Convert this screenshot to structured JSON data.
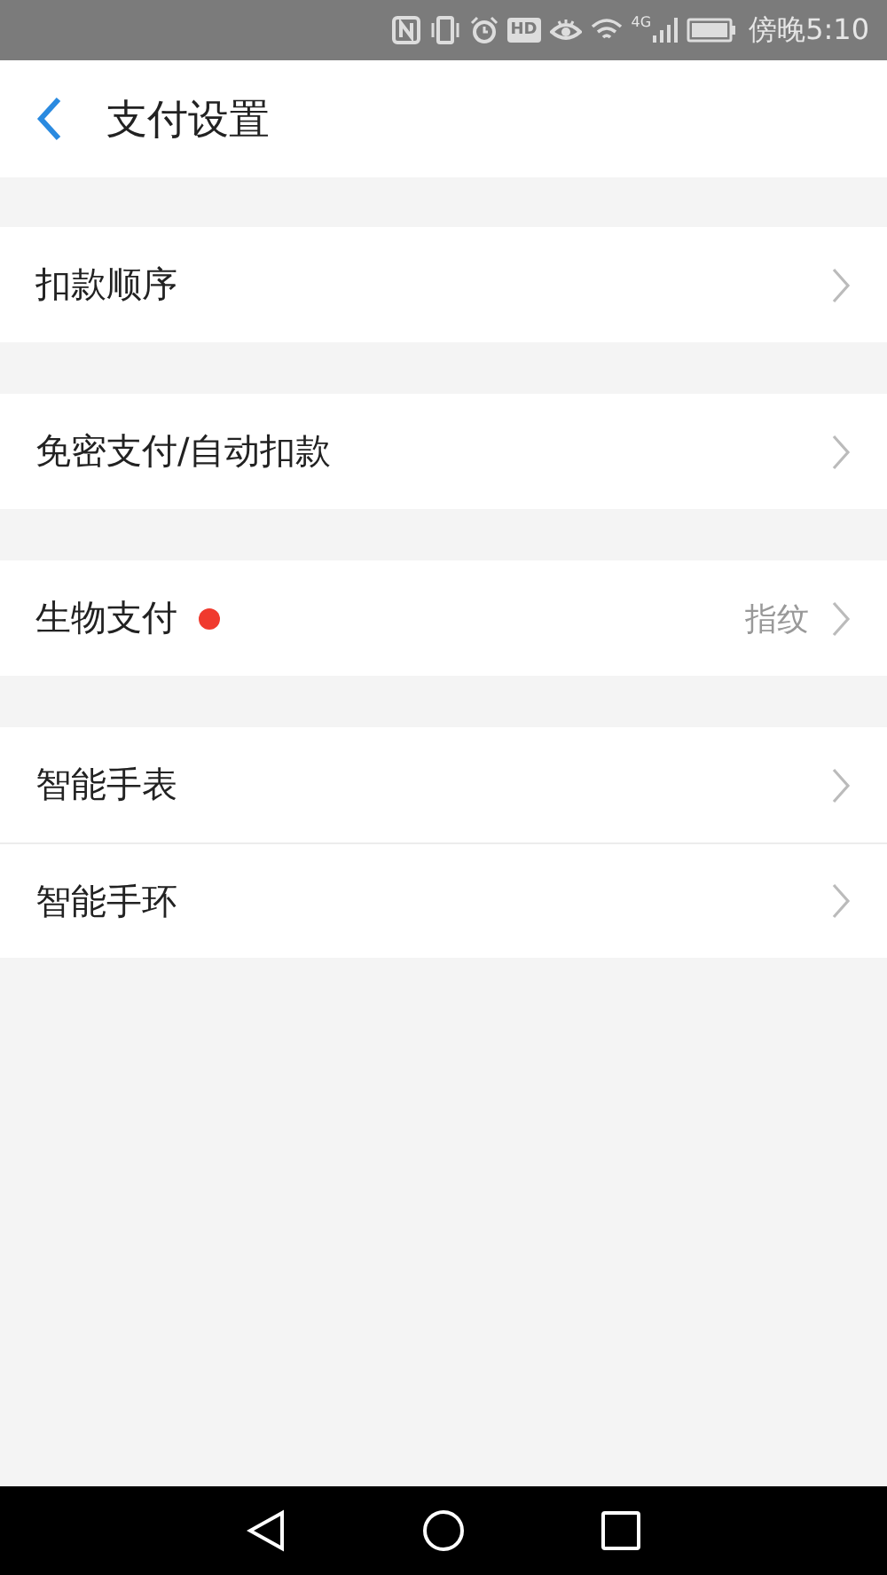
{
  "status_bar": {
    "hd": "HD",
    "network": "4G",
    "time": "傍晚5:10"
  },
  "header": {
    "title": "支付设置"
  },
  "groups": [
    {
      "items": [
        {
          "label": "扣款顺序",
          "dot": false
        }
      ]
    },
    {
      "items": [
        {
          "label": "免密支付/自动扣款",
          "dot": false
        }
      ]
    },
    {
      "items": [
        {
          "label": "生物支付",
          "dot": true,
          "value": "指纹"
        }
      ]
    },
    {
      "items": [
        {
          "label": "智能手表",
          "dot": false
        },
        {
          "label": "智能手环",
          "dot": false
        }
      ]
    }
  ]
}
